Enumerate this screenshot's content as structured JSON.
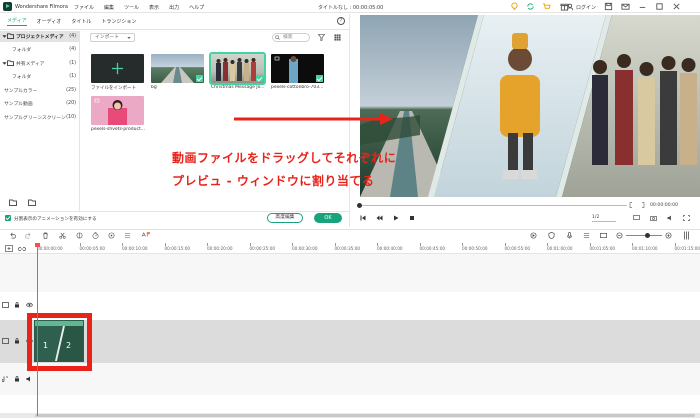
{
  "app": {
    "name": "Wondershare Filmora",
    "menu": [
      "ファイル",
      "編集",
      "ツール",
      "表示",
      "出力",
      "ヘルプ"
    ],
    "doc_title": "タイトルなし : 00:00:05:00",
    "login": "ログイン"
  },
  "tabs": [
    "メディア",
    "オーディオ",
    "タイトル",
    "トランジション"
  ],
  "sidebar": {
    "items": [
      {
        "label": "プロジェクトメディア",
        "count": "(4)"
      },
      {
        "label": "フォルダ",
        "count": "(4)"
      },
      {
        "label": "共有メディア",
        "count": "(1)"
      },
      {
        "label": "フォルダ",
        "count": "(1)"
      },
      {
        "label": "サンプルカラー",
        "count": "(25)"
      },
      {
        "label": "サンプル動画",
        "count": "(20)"
      },
      {
        "label": "サンプルグリーンスクリーン",
        "count": "(10)"
      }
    ]
  },
  "media": {
    "import_label": "インポート",
    "search_placeholder": "検索",
    "items": [
      {
        "label": "ファイルをインポート"
      },
      {
        "label": "bg"
      },
      {
        "label": "Christmas Message Jo..."
      },
      {
        "label": "pexels-cottonbro-703..."
      },
      {
        "label": "pexels-shvets-product..."
      }
    ]
  },
  "bottom": {
    "anim_label": "分割表示のアニメーションを有効にする",
    "advanced_label": "高度編集",
    "ok_label": "OK"
  },
  "preview": {
    "time": "00:00:00:00",
    "ratio": "1/2",
    "panels": [
      "1",
      "2"
    ]
  },
  "annotation": {
    "line1": "動画ファイルをドラッグしてそれぞれに",
    "line2": "プレビュ - ウィンドウに割り当てる"
  },
  "timeline": {
    "ticks": [
      "00:00:00:00",
      "00:00:05:00",
      "00:00:10:00",
      "00:00:15:00",
      "00:00:20:00",
      "00:00:25:00",
      "00:00:30:00",
      "00:00:35:00",
      "00:00:40:00",
      "00:00:45:00",
      "00:00:50:00",
      "00:00:55:00",
      "00:01:00:00",
      "00:01:05:00",
      "00:01:10:00",
      "00:01:15:00"
    ],
    "clip_panels": [
      "1",
      "2"
    ]
  },
  "colors": {
    "accent": "#19a37c",
    "annotation": "#e8231a"
  }
}
